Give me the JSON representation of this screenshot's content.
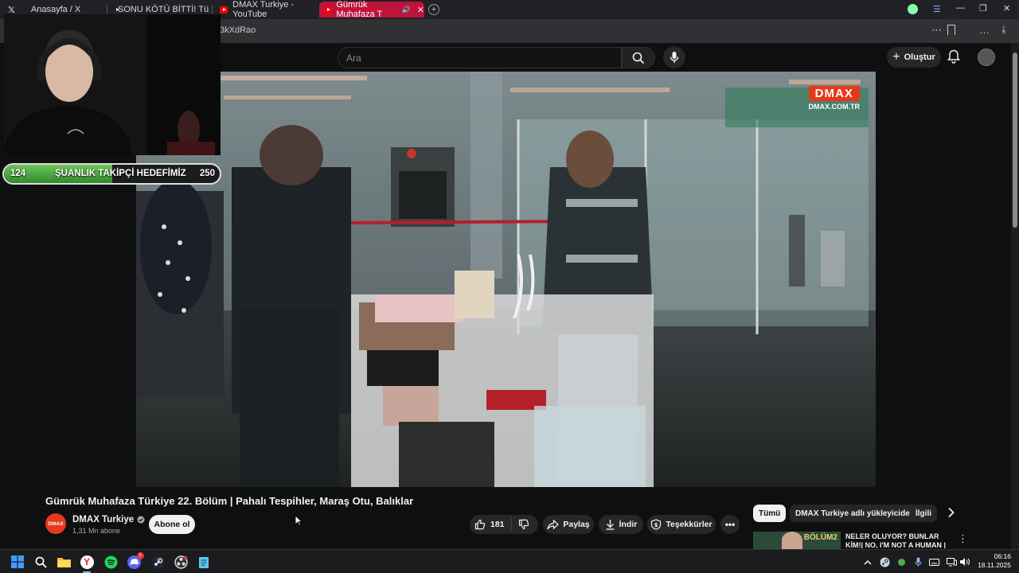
{
  "browser": {
    "tabs": [
      {
        "label": "Anasayfa / X",
        "icon": "x-logo-icon"
      },
      {
        "label": "SONU KÖTÜ BİTTİ! Türkiy",
        "icon": "youtube-icon"
      },
      {
        "label": "DMAX Turkiye - YouTube",
        "icon": "youtube-icon"
      },
      {
        "label": "Gümrük Muhafaza T",
        "icon": "youtube-icon",
        "active": true
      }
    ],
    "url": "3kXdRao"
  },
  "youtube": {
    "search_placeholder": "Ara",
    "create_label": "Oluştur"
  },
  "overlay": {
    "goal_start": "124",
    "goal_label": "ŞUANLIK TAKİPÇİ HEDEFİMİZ",
    "goal_end": "250",
    "goal_progress_fraction": 0.5
  },
  "video": {
    "watermark_logo": "DMAX",
    "watermark_site": "DMAX.COM.TR",
    "title": "Gümrük Muhafaza Türkiye 22. Bölüm | Pahalı Tespihler, Maraş Otu, Balıklar"
  },
  "channel": {
    "avatar_text": "DMAX",
    "name": "DMAX Turkiye",
    "subscribers": "1,31 Mn abone",
    "subscribe_label": "Abone ol"
  },
  "actions": {
    "like_count": "181",
    "share_label": "Paylaş",
    "download_label": "İndir",
    "thanks_label": "Teşekkürler"
  },
  "sidebar": {
    "chips": [
      "Tümü",
      "DMAX Turkiye adlı yükleyiciden",
      "İlgili"
    ],
    "recommendation": {
      "thumb_label": "BÖLÜM2",
      "title": "NELER OLUYOR? BUNLAR KİM!| NO, I'M NOT A HUMAN | BÖLÜ"
    }
  },
  "taskbar": {
    "time": "06:16",
    "date": "18.11.2025",
    "discord_badge": "1"
  },
  "colors": {
    "youtube_red": "#ff0000",
    "active_tab": "#c0133a",
    "dmax_orange": "#e8381b",
    "goal_green": "#4caf50"
  }
}
